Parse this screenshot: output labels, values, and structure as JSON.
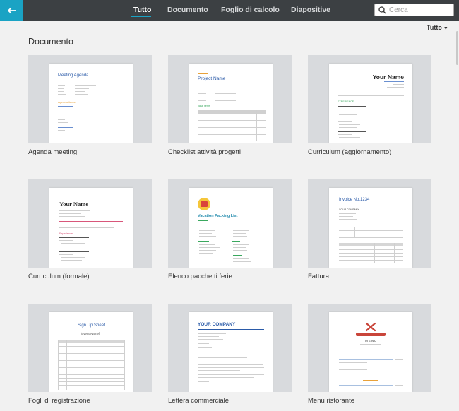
{
  "header": {
    "tabs": [
      {
        "label": "Tutto",
        "active": true
      },
      {
        "label": "Documento",
        "active": false
      },
      {
        "label": "Foglio di calcolo",
        "active": false
      },
      {
        "label": "Diapositive",
        "active": false
      }
    ],
    "search_placeholder": "Cerca",
    "accent": "#1aa3c4",
    "bar_color": "#3c4043"
  },
  "filter": {
    "label": "Tutto"
  },
  "section": {
    "title": "Documento"
  },
  "cards": [
    {
      "label": "Agenda meeting",
      "thumb": {
        "title": "Meeting Agenda",
        "heading": "Agenda items"
      }
    },
    {
      "label": "Checklist attività progetti",
      "thumb": {
        "title": "Project Name",
        "heading": "Task items"
      }
    },
    {
      "label": "Curriculum (aggiornamento)",
      "thumb": {
        "title": "Your Name",
        "heading": "EXPERIENCE"
      }
    },
    {
      "label": "Curriculum (formale)",
      "thumb": {
        "title": "Your Name",
        "heading": "Experience"
      }
    },
    {
      "label": "Elenco pacchetti ferie",
      "thumb": {
        "title": "Vacation Packing List"
      }
    },
    {
      "label": "Fattura",
      "thumb": {
        "title": "Invoice No.1234",
        "company": "YOUR COMPANY"
      }
    },
    {
      "label": "Fogli di registrazione",
      "thumb": {
        "title": "Sign Up Sheet",
        "subtitle": "[Event Name]"
      }
    },
    {
      "label": "Lettera commerciale",
      "thumb": {
        "title": "YOUR COMPANY"
      }
    },
    {
      "label": "Menu ristorante",
      "thumb": {
        "title": "MENU"
      }
    }
  ]
}
